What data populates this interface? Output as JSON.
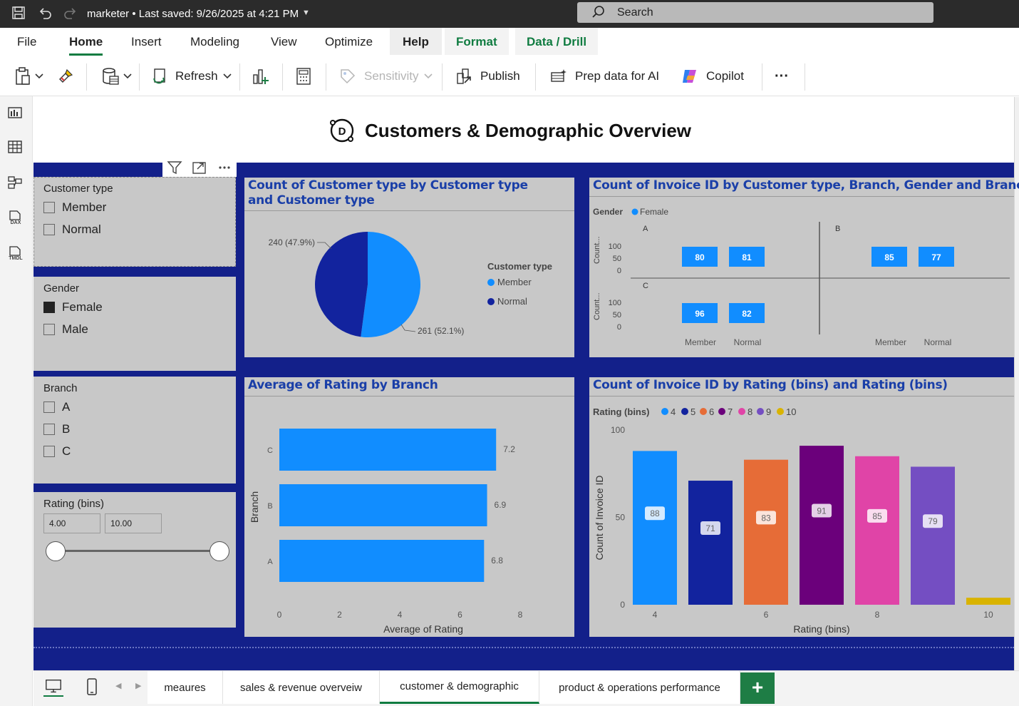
{
  "titlebar": {
    "file_label": "marketer",
    "saved_label": "Last saved: 9/26/2025 at 4:21 PM",
    "search_placeholder": "Search"
  },
  "menu": {
    "tabs": [
      "File",
      "Home",
      "Insert",
      "Modeling",
      "View",
      "Optimize",
      "Help",
      "Format",
      "Data / Drill"
    ],
    "active": "Home"
  },
  "ribbon": {
    "refresh": "Refresh",
    "sensitivity": "Sensitivity",
    "publish": "Publish",
    "prep_ai": "Prep data for AI",
    "copilot": "Copilot",
    "more": "···"
  },
  "rail": {
    "dax_label": "DAX",
    "tmdl_label": "TMDL"
  },
  "report": {
    "title": "Customers & Demographic Overview",
    "logo_letter": "D"
  },
  "slicers": {
    "customer_type": {
      "title": "Customer type",
      "items": [
        {
          "label": "Member",
          "checked": false
        },
        {
          "label": "Normal",
          "checked": false
        }
      ]
    },
    "gender": {
      "title": "Gender",
      "items": [
        {
          "label": "Female",
          "checked": true
        },
        {
          "label": "Male",
          "checked": false
        }
      ]
    },
    "branch": {
      "title": "Branch",
      "items": [
        {
          "label": "A",
          "checked": false
        },
        {
          "label": "B",
          "checked": false
        },
        {
          "label": "C",
          "checked": false
        }
      ]
    },
    "rating": {
      "title": "Rating (bins)",
      "min": "4.00",
      "max": "10.00"
    }
  },
  "visuals": {
    "pie_title": "Count of Customer type by Customer type and Customer type",
    "small_multiples_title": "Count of Invoice ID by Customer type, Branch, Gender and Branch",
    "bar_title": "Average of Rating by Branch",
    "column_title": "Count of Invoice ID by Rating (bins) and Rating (bins)"
  },
  "colors": {
    "accent_blue": "#118dff",
    "navy": "#12239e",
    "panel": "#c8c8c8",
    "title_blue": "#1a3fa8"
  },
  "chart_data": [
    {
      "type": "pie",
      "legend_title": "Customer type",
      "categories": [
        "Member",
        "Normal"
      ],
      "values": [
        261,
        240
      ],
      "labels": [
        "261 (52.1%)",
        "240 (47.9%)"
      ],
      "colors": [
        "#118dff",
        "#12239e"
      ],
      "legend_position": "right"
    },
    {
      "type": "bar",
      "legend_title": "Gender",
      "legend": [
        "Female"
      ],
      "yaxis_label": "Count...",
      "y_ticks": [
        "100",
        "50",
        "0"
      ],
      "categories": [
        "Member",
        "Normal"
      ],
      "panels": [
        {
          "branch": "A",
          "values": [
            80,
            81
          ]
        },
        {
          "branch": "B",
          "values": [
            85,
            77
          ]
        },
        {
          "branch": "C",
          "values": [
            96,
            82
          ]
        }
      ]
    },
    {
      "type": "bar",
      "orientation": "horizontal",
      "categories": [
        "C",
        "B",
        "A"
      ],
      "values": [
        7.2,
        6.9,
        6.8
      ],
      "xlabel": "Average of Rating",
      "ylabel": "Branch",
      "x_ticks": [
        0,
        2,
        4,
        6,
        8
      ],
      "xlim": [
        0,
        8
      ]
    },
    {
      "type": "bar",
      "legend_title": "Rating (bins)",
      "legend": [
        "4",
        "5",
        "6",
        "7",
        "8",
        "9",
        "10"
      ],
      "colors": [
        "#118dff",
        "#12239e",
        "#e66c37",
        "#6b007b",
        "#e044a7",
        "#744ec2",
        "#d9b300"
      ],
      "categories": [
        "4",
        "5",
        "6",
        "7",
        "8",
        "9",
        "10"
      ],
      "values": [
        88,
        71,
        83,
        91,
        85,
        79,
        4
      ],
      "data_labels": [
        "88",
        "71",
        "83",
        "91",
        "85",
        "79",
        ""
      ],
      "x_ticks": [
        "4",
        "6",
        "8",
        "10"
      ],
      "y_ticks": [
        0,
        50,
        100
      ],
      "ylim": [
        0,
        100
      ],
      "xlabel": "Rating (bins)",
      "ylabel": "Count of Invoice ID"
    }
  ],
  "page_tabs": [
    {
      "label": "meaures",
      "active": false
    },
    {
      "label": "sales & revenue overveiw",
      "active": false
    },
    {
      "label": "customer & demographic",
      "active": true
    },
    {
      "label": "product & operations performance",
      "active": false
    }
  ],
  "add_tab": "+"
}
